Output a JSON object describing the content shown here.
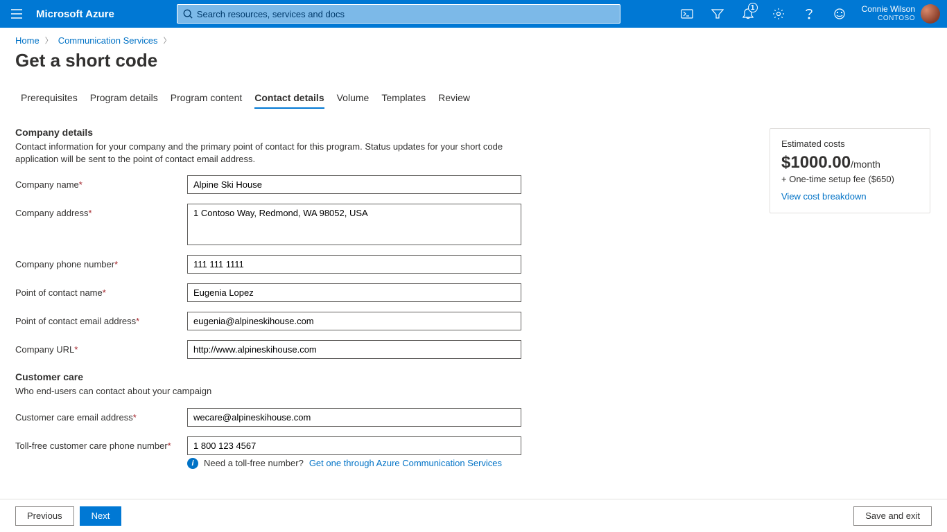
{
  "topbar": {
    "brand": "Microsoft Azure",
    "search_placeholder": "Search resources, services and docs",
    "notification_count": "1",
    "user_name": "Connie Wilson",
    "user_org": "CONTOSO"
  },
  "breadcrumb": {
    "home": "Home",
    "section": "Communication Services"
  },
  "title": "Get a short code",
  "tabs": [
    {
      "label": "Prerequisites",
      "active": false
    },
    {
      "label": "Program details",
      "active": false
    },
    {
      "label": "Program content",
      "active": false
    },
    {
      "label": "Contact details",
      "active": true
    },
    {
      "label": "Volume",
      "active": false
    },
    {
      "label": "Templates",
      "active": false
    },
    {
      "label": "Review",
      "active": false
    }
  ],
  "company": {
    "heading": "Company details",
    "desc": "Contact information for your company and the primary point of contact for this program. Status updates for your short code application will be sent to the point of contact email address.",
    "name_label": "Company name",
    "name_value": "Alpine Ski House",
    "address_label": "Company address",
    "address_value": "1 Contoso Way, Redmond, WA 98052, USA",
    "phone_label": "Company phone number",
    "phone_value": "111 111 1111",
    "poc_name_label": "Point of contact name",
    "poc_name_value": "Eugenia Lopez",
    "poc_email_label": "Point of contact email address",
    "poc_email_value": "eugenia@alpineskihouse.com",
    "url_label": "Company URL",
    "url_value": "http://www.alpineskihouse.com"
  },
  "care": {
    "heading": "Customer care",
    "desc": "Who end-users can contact about your campaign",
    "email_label": "Customer care email address",
    "email_value": "wecare@alpineskihouse.com",
    "phone_label": "Toll-free customer care phone number",
    "phone_value": "1 800 123 4567",
    "info_prefix": "Need a toll-free number?",
    "info_link": "Get one through Azure Communication Services"
  },
  "costs": {
    "title": "Estimated costs",
    "amount": "$1000.00",
    "suffix": "/month",
    "line2": "+ One-time setup fee ($650)",
    "link": "View cost breakdown"
  },
  "footer": {
    "previous": "Previous",
    "next": "Next",
    "save": "Save and exit"
  }
}
